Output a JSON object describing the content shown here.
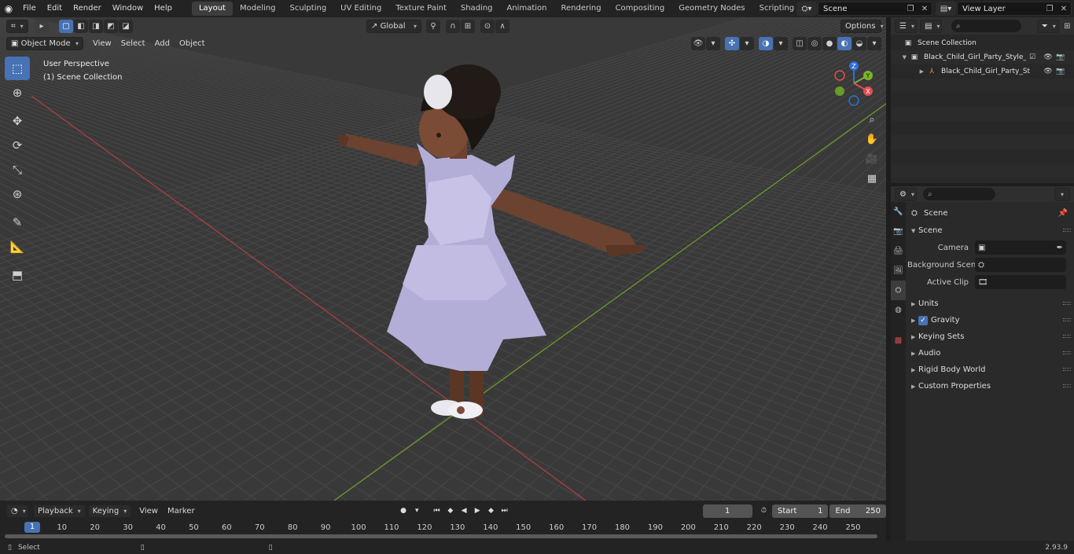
{
  "menubar": {
    "items": [
      "File",
      "Edit",
      "Render",
      "Window",
      "Help"
    ],
    "workspaces": [
      "Layout",
      "Modeling",
      "Sculpting",
      "UV Editing",
      "Texture Paint",
      "Shading",
      "Animation",
      "Rendering",
      "Compositing",
      "Geometry Nodes",
      "Scripting"
    ],
    "active_workspace": "Layout",
    "add_workspace": "+",
    "scene_name": "Scene",
    "view_layer": "View Layer"
  },
  "viewport": {
    "mode": "Object Mode",
    "menus": [
      "View",
      "Select",
      "Add",
      "Object"
    ],
    "transform_orientation": "Global",
    "options_label": "Options",
    "perspective_label": "User Perspective",
    "collection_label": "(1) Scene Collection",
    "gizmo_axes": [
      "Z",
      "Y",
      "X"
    ]
  },
  "toolbar": {
    "tools": [
      "select-box",
      "cursor",
      "move",
      "rotate",
      "scale",
      "transform",
      "annotate",
      "measure",
      "add-cube"
    ],
    "active": "select-box"
  },
  "timeline": {
    "menus": [
      "Playback",
      "Keying",
      "View",
      "Marker"
    ],
    "current_frame": "1",
    "start_label": "Start",
    "start_value": "1",
    "end_label": "End",
    "end_value": "250",
    "ticks": [
      "1",
      "10",
      "20",
      "30",
      "40",
      "50",
      "60",
      "70",
      "80",
      "90",
      "100",
      "110",
      "120",
      "130",
      "140",
      "150",
      "160",
      "170",
      "180",
      "190",
      "200",
      "210",
      "220",
      "230",
      "240",
      "250"
    ]
  },
  "statusbar": {
    "left_label": "Select",
    "version": "2.93.9"
  },
  "outliner": {
    "root": "Scene Collection",
    "collection": "Black_Child_Girl_Party_Style_",
    "object": "Black_Child_Girl_Party_St"
  },
  "properties": {
    "context": "Scene",
    "section": "Scene",
    "rows": [
      {
        "label": "Camera",
        "value": ""
      },
      {
        "label": "Background Scene",
        "value": ""
      },
      {
        "label": "Active Clip",
        "value": ""
      }
    ],
    "panels": [
      "Units",
      "Gravity",
      "Keying Sets",
      "Audio",
      "Rigid Body World",
      "Custom Properties"
    ],
    "gravity_checked": true
  },
  "colors": {
    "accent": "#4772b3",
    "viewport_bg": "#393939",
    "x_axis": "#a8413f",
    "y_axis": "#6e9a2c"
  }
}
